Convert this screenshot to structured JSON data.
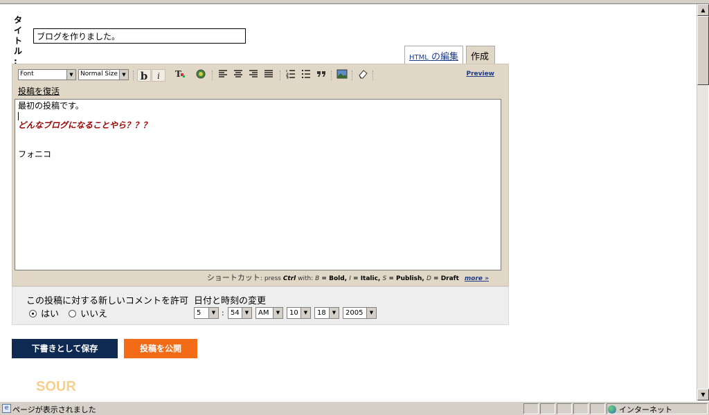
{
  "form": {
    "title_label_chars": [
      "タ",
      "イ",
      "ト",
      "ル",
      ":"
    ],
    "title_value": "ブログを作りました。"
  },
  "tabs": {
    "html_prefix": "HTML",
    "html_suffix": " の編集",
    "compose": "作成"
  },
  "toolbar": {
    "font_select": "Font",
    "size_select": "Normal Size",
    "bold": "b",
    "italic": "i",
    "preview": "Preview",
    "restore": "投稿を復活"
  },
  "post": {
    "line1": "最初の投稿です。",
    "line2": "どんなブログになることやら？？？",
    "line3": "フォニコ"
  },
  "shortcuts": {
    "label": "ショートカット",
    "press": ": press ",
    "ctrl": "Ctrl",
    "with": " with: ",
    "b_key": "B",
    "b_text": " = Bold, ",
    "i_key": "I",
    "i_text": " = Italic, ",
    "s_key": "S",
    "s_text": " = Publish, ",
    "d_key": "D",
    "d_text": " = Draft",
    "more": "more »"
  },
  "options": {
    "comment_label": "この投稿に対する新しいコメントを許可",
    "yes": "はい",
    "no": "いいえ",
    "yes_selected": true,
    "date_label": "日付と時刻の変更",
    "hour": "5",
    "minute": "54",
    "ampm": "AM",
    "month": "10",
    "day": "18",
    "year": "2005"
  },
  "buttons": {
    "save_draft": "下書きとして保存",
    "publish": "投稿を公開"
  },
  "logo_text": "SOUR",
  "statusbar": {
    "message": "ページが表示されました",
    "zone": "インターネット"
  }
}
